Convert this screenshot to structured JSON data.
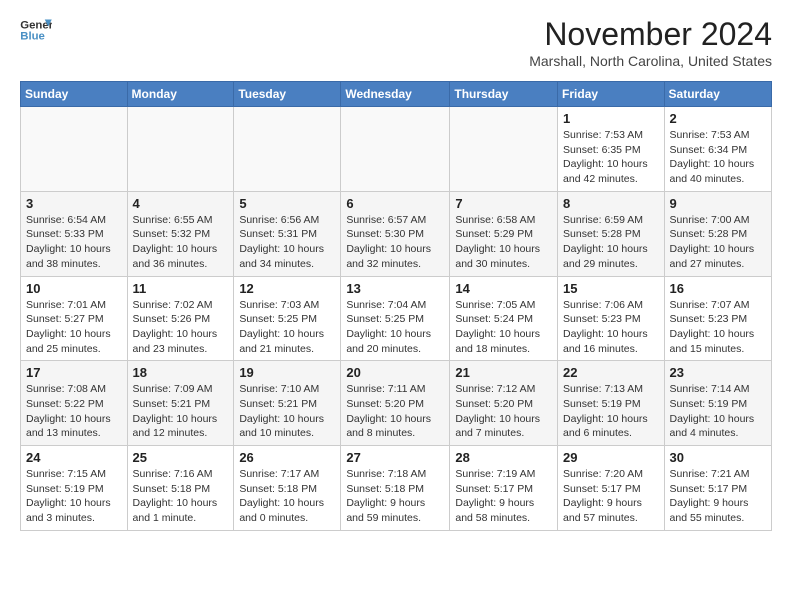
{
  "header": {
    "logo_line1": "General",
    "logo_line2": "Blue",
    "month": "November 2024",
    "location": "Marshall, North Carolina, United States"
  },
  "days_of_week": [
    "Sunday",
    "Monday",
    "Tuesday",
    "Wednesday",
    "Thursday",
    "Friday",
    "Saturday"
  ],
  "weeks": [
    [
      {
        "day": "",
        "detail": ""
      },
      {
        "day": "",
        "detail": ""
      },
      {
        "day": "",
        "detail": ""
      },
      {
        "day": "",
        "detail": ""
      },
      {
        "day": "",
        "detail": ""
      },
      {
        "day": "1",
        "detail": "Sunrise: 7:53 AM\nSunset: 6:35 PM\nDaylight: 10 hours and 42 minutes."
      },
      {
        "day": "2",
        "detail": "Sunrise: 7:53 AM\nSunset: 6:34 PM\nDaylight: 10 hours and 40 minutes."
      }
    ],
    [
      {
        "day": "3",
        "detail": "Sunrise: 6:54 AM\nSunset: 5:33 PM\nDaylight: 10 hours and 38 minutes."
      },
      {
        "day": "4",
        "detail": "Sunrise: 6:55 AM\nSunset: 5:32 PM\nDaylight: 10 hours and 36 minutes."
      },
      {
        "day": "5",
        "detail": "Sunrise: 6:56 AM\nSunset: 5:31 PM\nDaylight: 10 hours and 34 minutes."
      },
      {
        "day": "6",
        "detail": "Sunrise: 6:57 AM\nSunset: 5:30 PM\nDaylight: 10 hours and 32 minutes."
      },
      {
        "day": "7",
        "detail": "Sunrise: 6:58 AM\nSunset: 5:29 PM\nDaylight: 10 hours and 30 minutes."
      },
      {
        "day": "8",
        "detail": "Sunrise: 6:59 AM\nSunset: 5:28 PM\nDaylight: 10 hours and 29 minutes."
      },
      {
        "day": "9",
        "detail": "Sunrise: 7:00 AM\nSunset: 5:28 PM\nDaylight: 10 hours and 27 minutes."
      }
    ],
    [
      {
        "day": "10",
        "detail": "Sunrise: 7:01 AM\nSunset: 5:27 PM\nDaylight: 10 hours and 25 minutes."
      },
      {
        "day": "11",
        "detail": "Sunrise: 7:02 AM\nSunset: 5:26 PM\nDaylight: 10 hours and 23 minutes."
      },
      {
        "day": "12",
        "detail": "Sunrise: 7:03 AM\nSunset: 5:25 PM\nDaylight: 10 hours and 21 minutes."
      },
      {
        "day": "13",
        "detail": "Sunrise: 7:04 AM\nSunset: 5:25 PM\nDaylight: 10 hours and 20 minutes."
      },
      {
        "day": "14",
        "detail": "Sunrise: 7:05 AM\nSunset: 5:24 PM\nDaylight: 10 hours and 18 minutes."
      },
      {
        "day": "15",
        "detail": "Sunrise: 7:06 AM\nSunset: 5:23 PM\nDaylight: 10 hours and 16 minutes."
      },
      {
        "day": "16",
        "detail": "Sunrise: 7:07 AM\nSunset: 5:23 PM\nDaylight: 10 hours and 15 minutes."
      }
    ],
    [
      {
        "day": "17",
        "detail": "Sunrise: 7:08 AM\nSunset: 5:22 PM\nDaylight: 10 hours and 13 minutes."
      },
      {
        "day": "18",
        "detail": "Sunrise: 7:09 AM\nSunset: 5:21 PM\nDaylight: 10 hours and 12 minutes."
      },
      {
        "day": "19",
        "detail": "Sunrise: 7:10 AM\nSunset: 5:21 PM\nDaylight: 10 hours and 10 minutes."
      },
      {
        "day": "20",
        "detail": "Sunrise: 7:11 AM\nSunset: 5:20 PM\nDaylight: 10 hours and 8 minutes."
      },
      {
        "day": "21",
        "detail": "Sunrise: 7:12 AM\nSunset: 5:20 PM\nDaylight: 10 hours and 7 minutes."
      },
      {
        "day": "22",
        "detail": "Sunrise: 7:13 AM\nSunset: 5:19 PM\nDaylight: 10 hours and 6 minutes."
      },
      {
        "day": "23",
        "detail": "Sunrise: 7:14 AM\nSunset: 5:19 PM\nDaylight: 10 hours and 4 minutes."
      }
    ],
    [
      {
        "day": "24",
        "detail": "Sunrise: 7:15 AM\nSunset: 5:19 PM\nDaylight: 10 hours and 3 minutes."
      },
      {
        "day": "25",
        "detail": "Sunrise: 7:16 AM\nSunset: 5:18 PM\nDaylight: 10 hours and 1 minute."
      },
      {
        "day": "26",
        "detail": "Sunrise: 7:17 AM\nSunset: 5:18 PM\nDaylight: 10 hours and 0 minutes."
      },
      {
        "day": "27",
        "detail": "Sunrise: 7:18 AM\nSunset: 5:18 PM\nDaylight: 9 hours and 59 minutes."
      },
      {
        "day": "28",
        "detail": "Sunrise: 7:19 AM\nSunset: 5:17 PM\nDaylight: 9 hours and 58 minutes."
      },
      {
        "day": "29",
        "detail": "Sunrise: 7:20 AM\nSunset: 5:17 PM\nDaylight: 9 hours and 57 minutes."
      },
      {
        "day": "30",
        "detail": "Sunrise: 7:21 AM\nSunset: 5:17 PM\nDaylight: 9 hours and 55 minutes."
      }
    ]
  ]
}
